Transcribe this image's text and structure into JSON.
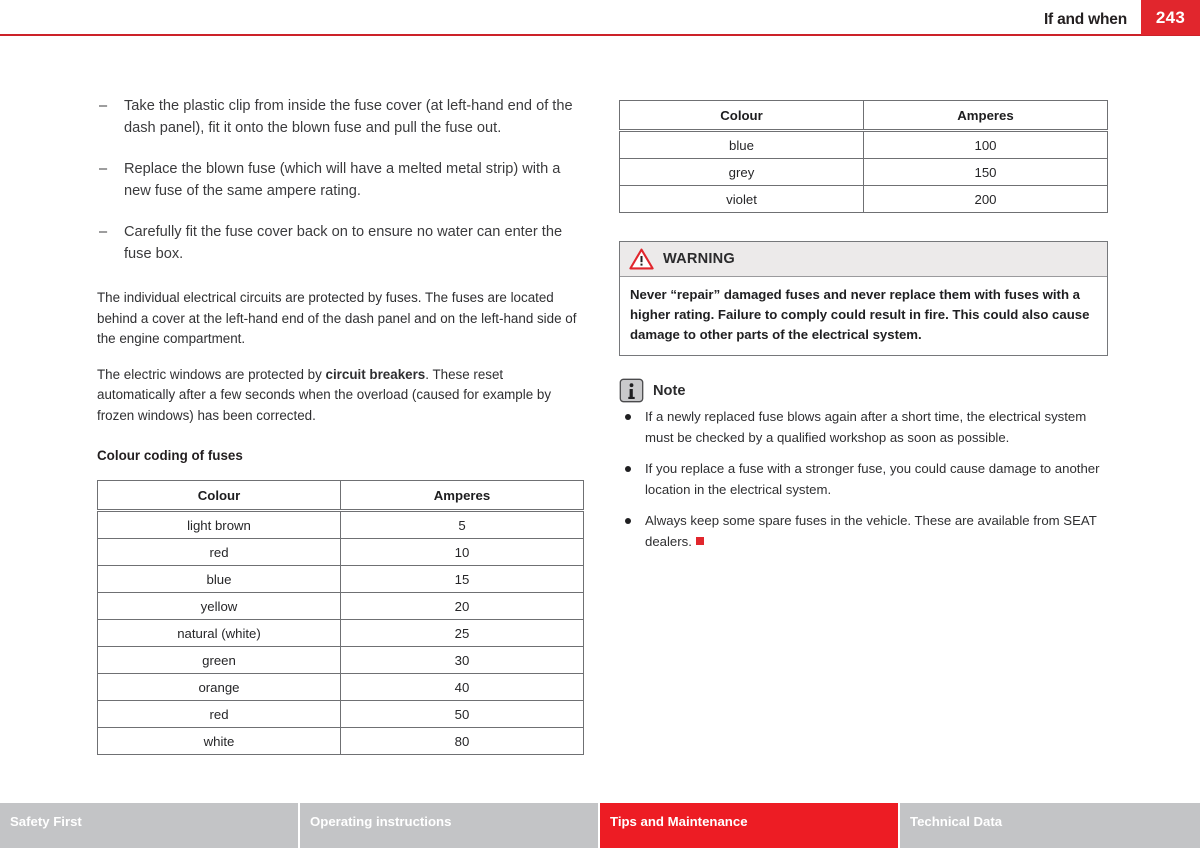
{
  "header": {
    "title": "If and when",
    "page_number": "243",
    "accent_color": "#cc2229",
    "page_box_color": "#e1262d"
  },
  "left_column": {
    "dash_items": [
      "Take the plastic clip from inside the fuse cover (at left-hand end of the dash panel), fit it onto the blown fuse and pull the fuse out.",
      "Replace the blown fuse (which will have a melted metal strip) with a new fuse of the same ampere rating.",
      "Carefully fit the fuse cover back on to ensure no water can enter the fuse box."
    ],
    "dash_mark": "–",
    "paragraph_1": "The individual electrical circuits are protected by fuses. The fuses are located behind a cover at the left-hand end of the dash panel and on the left-hand side of the engine compartment.",
    "paragraph_2_part1": "The electric windows are protected by ",
    "paragraph_2_bold": "circuit breakers",
    "paragraph_2_part2": ". These reset automatically after a few seconds when the overload (caused for example by frozen windows) has been corrected.",
    "sub_heading": "Colour coding of fuses",
    "table": {
      "headers": [
        "Colour",
        "Amperes"
      ],
      "rows": [
        [
          "light brown",
          "5"
        ],
        [
          "red",
          "10"
        ],
        [
          "blue",
          "15"
        ],
        [
          "yellow",
          "20"
        ],
        [
          "natural (white)",
          "25"
        ],
        [
          "green",
          "30"
        ],
        [
          "orange",
          "40"
        ],
        [
          "red",
          "50"
        ],
        [
          "white",
          "80"
        ]
      ]
    }
  },
  "right_column": {
    "table": {
      "headers": [
        "Colour",
        "Amperes"
      ],
      "rows": [
        [
          "blue",
          "100"
        ],
        [
          "grey",
          "150"
        ],
        [
          "violet",
          "200"
        ]
      ]
    },
    "warning": {
      "title": "WARNING",
      "body": "Never “repair” damaged fuses and never replace them with fuses with a higher rating. Failure to comply could result in fire. This could also cause damage to other parts of the electrical system.",
      "icon_color": "#e1262d"
    },
    "note": {
      "title": "Note",
      "items": [
        "If a newly replaced fuse blows again after a short time, the electrical system must be checked by a qualified workshop as soon as possible.",
        "If you replace a fuse with a stronger fuse, you could cause damage to another location in the electrical system.",
        "Always keep some spare fuses in the vehicle. These are available from SEAT dealers."
      ],
      "end_marker_color": "#e1262d"
    }
  },
  "footer": {
    "tabs": [
      {
        "label": "Safety First",
        "active": false
      },
      {
        "label": "Operating instructions",
        "active": false
      },
      {
        "label": "Tips and Maintenance",
        "active": true
      },
      {
        "label": "Technical Data",
        "active": false
      }
    ],
    "active_color": "#ed1c24",
    "inactive_color": "#c3c4c6"
  }
}
